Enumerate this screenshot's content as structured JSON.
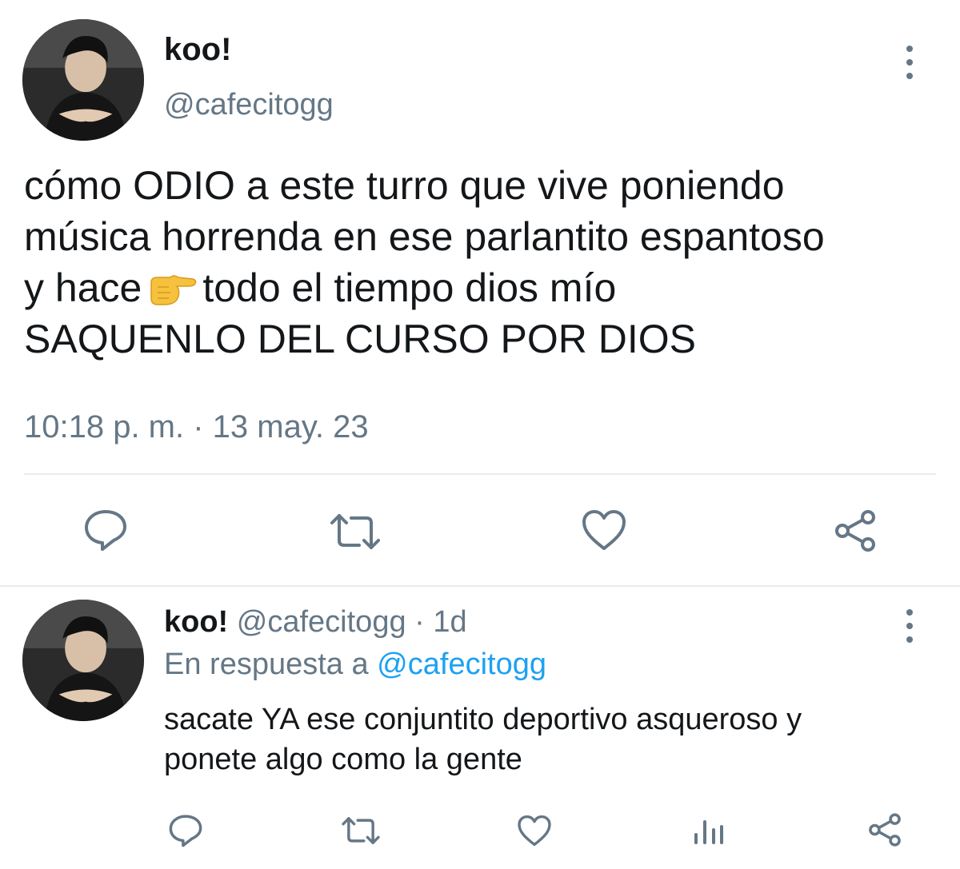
{
  "main_tweet": {
    "author_name": "koo!",
    "author_handle": "@cafecitogg",
    "text_lines": [
      "cómo ODIO a este turro que vive poniendo",
      "música horrenda en ese parlantito espantoso",
      "todo el tiempo dios mío",
      "SAQUENLO DEL CURSO POR DIOS"
    ],
    "text_line3_prefix": "y hace",
    "emoji": "backhand-index-pointing-right",
    "timestamp": "10:18 p. m. · 13 may. 23",
    "actions": [
      "reply-icon",
      "retweet-icon",
      "like-icon",
      "share-icon"
    ],
    "more_icon": "more-vertical-icon"
  },
  "reply_tweet": {
    "author_name": "koo!",
    "meta": "@cafecitogg · 1d",
    "in_reply_prefix": "En respuesta a",
    "in_reply_mention": "@cafecitogg",
    "text_lines": [
      "sacate YA ese conjuntito deportivo asqueroso y",
      "ponete algo como la gente"
    ],
    "actions": [
      "reply-icon",
      "retweet-icon",
      "like-icon",
      "analytics-icon",
      "share-icon"
    ],
    "more_icon": "more-vertical-icon"
  },
  "colors": {
    "text": "#14171a",
    "secondary": "#657786",
    "link": "#1da1f2",
    "divider": "#e6ecf0",
    "emoji": "#f6c13d"
  }
}
